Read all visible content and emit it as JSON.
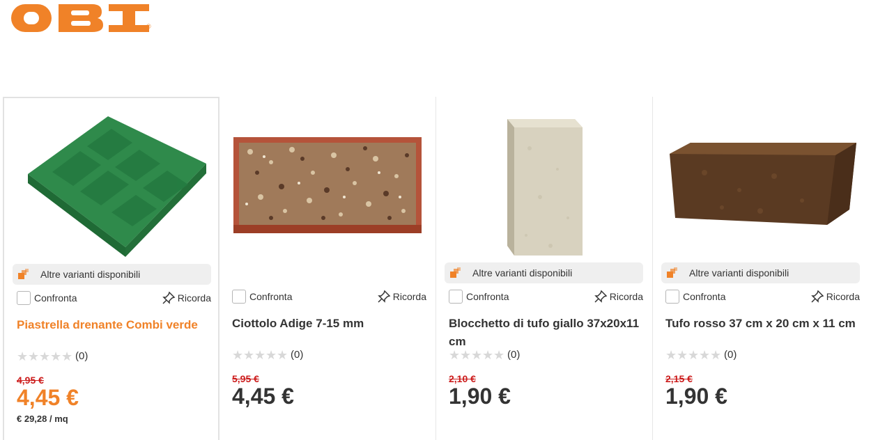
{
  "brand": {
    "name": "OBI",
    "color": "#f08228"
  },
  "colors": {
    "accent": "#f08228",
    "old_price": "#cc1c1c",
    "variant_bg": "#efefef"
  },
  "products": [
    {
      "title": "Piastrella drenante Combi verde",
      "variants": "Altre varianti disponibili",
      "compare": "Confronta",
      "remember": "Ricorda",
      "rating_count": "(0)",
      "rating": 0,
      "old_price": "4,95 €",
      "price": "4,45 €",
      "unit_price": "€ 29,28 / mq",
      "image": "green-drainage-tile"
    },
    {
      "title": "Ciottolo Adige 7-15 mm",
      "compare": "Confronta",
      "remember": "Ricorda",
      "rating_count": "(0)",
      "rating": 0,
      "old_price": "5,95 €",
      "price": "4,45 €",
      "image": "pebbles-tray"
    },
    {
      "title": "Blocchetto di tufo giallo 37x20x11 cm",
      "variants": "Altre varianti disponibili",
      "compare": "Confronta",
      "remember": "Ricorda",
      "rating_count": "(0)",
      "rating": 0,
      "old_price": "2,10 €",
      "price": "1,90 €",
      "image": "yellow-tuff-block"
    },
    {
      "title": "Tufo rosso 37 cm x 20 cm x 11 cm",
      "variants": "Altre varianti disponibili",
      "compare": "Confronta",
      "remember": "Ricorda",
      "rating_count": "(0)",
      "rating": 0,
      "old_price": "2,15 €",
      "price": "1,90 €",
      "image": "red-tuff-block"
    }
  ]
}
